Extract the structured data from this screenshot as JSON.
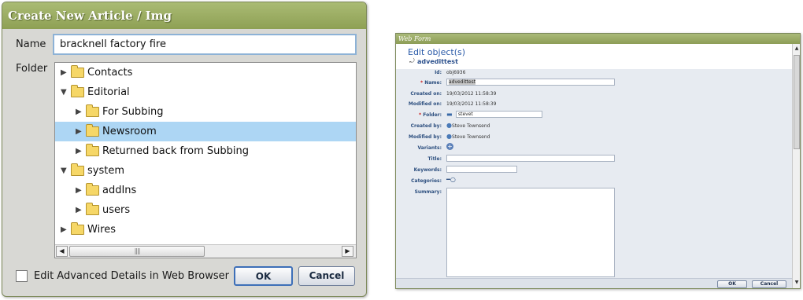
{
  "dialog1": {
    "title": "Create New Article / Img",
    "name_label": "Name",
    "name_value": "bracknell factory fire",
    "folder_label": "Folder",
    "tree": [
      {
        "label": "Contacts",
        "expanded": false,
        "selected": false
      },
      {
        "label": "Editorial",
        "expanded": true,
        "selected": false
      },
      {
        "label": "For Subbing",
        "expanded": false,
        "selected": false
      },
      {
        "label": "Newsroom",
        "expanded": false,
        "selected": true
      },
      {
        "label": "Returned back from Subbing",
        "expanded": false,
        "selected": false
      },
      {
        "label": "system",
        "expanded": true,
        "selected": false
      },
      {
        "label": "addIns",
        "expanded": false,
        "selected": false
      },
      {
        "label": "users",
        "expanded": false,
        "selected": false
      },
      {
        "label": "Wires",
        "expanded": false,
        "selected": false
      }
    ],
    "checkbox_label": "Edit Advanced Details in Web Browser",
    "checkbox_checked": false,
    "ok_label": "OK",
    "cancel_label": "Cancel"
  },
  "dialog2": {
    "title": "Web Form",
    "header_title": "Edit object(s)",
    "header_subtitle": "advedittest",
    "fields": {
      "id_label": "Id:",
      "id_value": "obj6936",
      "name_label": "Name:",
      "name_value": "advedittest",
      "created_label": "Created on:",
      "created_value": "19/03/2012 11:58:39",
      "modified_label": "Modified on:",
      "modified_value": "19/03/2012 11:58:39",
      "folder_label": "Folder:",
      "folder_value": "stevet",
      "created_by_label": "Created by:",
      "created_by_value": "Steve Townsend",
      "modified_by_label": "Modified by:",
      "modified_by_value": "Steve Townsend",
      "variants_label": "Variants:",
      "title_label": "Title:",
      "title_value": "",
      "keywords_label": "Keywords:",
      "keywords_value": "",
      "categories_label": "Categories:",
      "summary_label": "Summary:",
      "summary_value": ""
    },
    "ok_label": "OK",
    "cancel_label": "Cancel"
  },
  "colors": {
    "title_bar": "#9aab62",
    "selection": "#add6f4",
    "input_focus_border": "#8db2d6",
    "field_label": "#2d4f7f"
  }
}
